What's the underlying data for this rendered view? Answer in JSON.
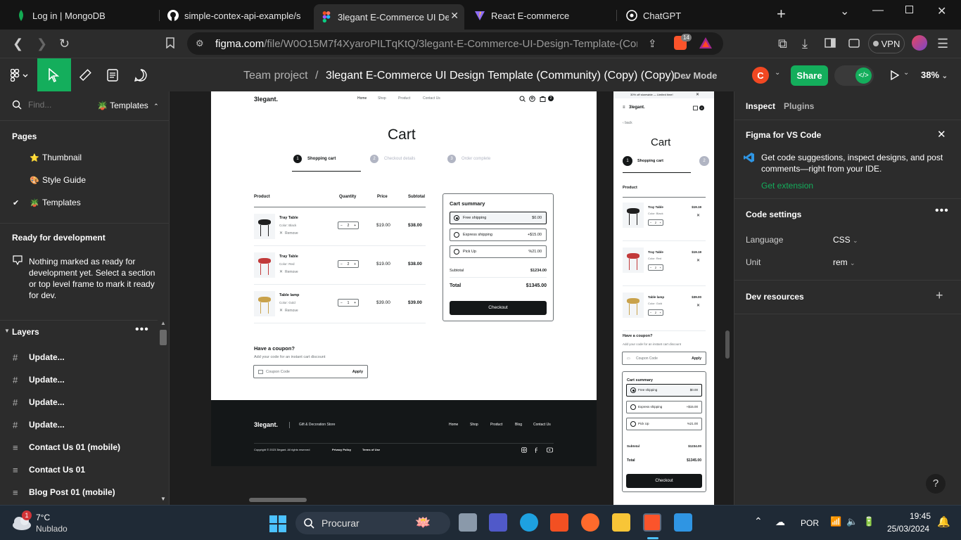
{
  "browser": {
    "tabs": [
      {
        "label": "Log in | MongoDB",
        "icon": "mongodb-leaf-icon",
        "active": false
      },
      {
        "label": "simple-contex-api-example/src/c",
        "icon": "github-icon",
        "active": false
      },
      {
        "label": "3legant E-Commerce UI Desig",
        "icon": "figma-icon",
        "active": true
      },
      {
        "label": "React E-commerce",
        "icon": "vite-icon",
        "active": false
      },
      {
        "label": "ChatGPT",
        "icon": "chatgpt-icon",
        "active": false
      }
    ],
    "url_host": "figma.com",
    "url_path": "/file/W0O15M7f4XyaroPILTqKtQ/3legant-E-Commerce-UI-Design-Template-(Commu...",
    "vpn_label": "VPN",
    "shield_badge": "14"
  },
  "figma": {
    "breadcrumb_team": "Team project",
    "breadcrumb_sep": "/",
    "file_title": "3legant E-Commerce UI Design Template (Community) (Copy) (Copy)",
    "dev_mode": "Dev Mode",
    "avatar_initial": "C",
    "share": "Share",
    "zoom": "38%"
  },
  "left_panel": {
    "search_placeholder": "Find...",
    "page_selector": "Templates",
    "pages_title": "Pages",
    "pages": [
      {
        "icon": "star-emoji-icon",
        "label": "Thumbnail"
      },
      {
        "icon": "palette-emoji-icon",
        "label": "Style Guide"
      },
      {
        "icon": "plant-emoji-icon",
        "label": "Templates",
        "checked": true
      }
    ],
    "ready_title": "Ready for development",
    "ready_text": "Nothing marked as ready for development yet. Select a section or top level frame to mark it ready for dev.",
    "layers_title": "Layers",
    "layers": [
      {
        "type": "frame-hash-icon",
        "label": "Update..."
      },
      {
        "type": "frame-hash-icon",
        "label": "Update..."
      },
      {
        "type": "frame-hash-icon",
        "label": "Update..."
      },
      {
        "type": "frame-hash-icon",
        "label": "Update..."
      },
      {
        "type": "section-lines-icon",
        "label": "Contact Us 01 (mobile)"
      },
      {
        "type": "section-lines-icon",
        "label": "Contact Us 01"
      },
      {
        "type": "section-lines-icon",
        "label": "Blog Post 01 (mobile)"
      }
    ]
  },
  "desktop_cart": {
    "logo": "3legant.",
    "nav": [
      "Home",
      "Shop",
      "Product",
      "Contact Us"
    ],
    "cart_count": "2",
    "title": "Cart",
    "steps": [
      {
        "num": "1",
        "label": "Shopping cart"
      },
      {
        "num": "2",
        "label": "Checkout details"
      },
      {
        "num": "3",
        "label": "Order complete"
      }
    ],
    "headers": {
      "product": "Product",
      "quantity": "Quantity",
      "price": "Price",
      "subtotal": "Subtotal"
    },
    "items": [
      {
        "name": "Tray Table",
        "color": "Color: Black",
        "remove": "Remove",
        "qty": "2",
        "price": "$19.00",
        "subtotal": "$38.00",
        "swatch": "#1f1f1f"
      },
      {
        "name": "Tray Table",
        "color": "Color: Red",
        "remove": "Remove",
        "qty": "2",
        "price": "$19.00",
        "subtotal": "$38.00",
        "swatch": "#c23a3a"
      },
      {
        "name": "Table lamp",
        "color": "Color: Gold",
        "remove": "Remove",
        "qty": "1",
        "price": "$39.00",
        "subtotal": "$39.00",
        "swatch": "#c9a24b"
      }
    ],
    "summary": {
      "title": "Cart summary",
      "options": [
        {
          "label": "Free shipping",
          "price": "$0.00",
          "selected": true
        },
        {
          "label": "Express shipping",
          "price": "+$15.00",
          "selected": false
        },
        {
          "label": "Pick Up",
          "price": "%21.00",
          "selected": false
        }
      ],
      "subtotal_label": "Subtotal",
      "subtotal_value": "$1234.00",
      "total_label": "Total",
      "total_value": "$1345.00",
      "checkout": "Checkout"
    },
    "coupon": {
      "title": "Have a coupon?",
      "subtitle": "Add your code for an instant cart discount",
      "placeholder": "Coupon Code",
      "apply": "Apply"
    },
    "footer": {
      "logo": "3legant.",
      "tagline": "Gift & Decoration Store",
      "links": [
        "Home",
        "Shop",
        "Product",
        "Blog",
        "Contact Us"
      ],
      "copyright": "Copyright © 2023 3legant. All rights reserved",
      "privacy": "Privacy Policy",
      "terms": "Terms of Use"
    }
  },
  "mobile_cart": {
    "promo": "30% off storewide — Limited time!",
    "logo": "3legant.",
    "cart_count": "2",
    "back": "back",
    "title": "Cart",
    "step1": "Shopping cart",
    "step2_num": "2",
    "step1_num": "1",
    "product_header": "Product",
    "items": [
      {
        "name": "Tray Table",
        "color": "Color: Black",
        "price": "$19.19",
        "qty": "2",
        "swatch": "#1f1f1f"
      },
      {
        "name": "Tray Table",
        "color": "Color: Red",
        "price": "$19.19",
        "qty": "2",
        "swatch": "#c23a3a"
      },
      {
        "name": "Table lamp",
        "color": "Color: Gold",
        "price": "$39.00",
        "qty": "2",
        "swatch": "#c9a24b"
      }
    ],
    "coupon_title": "Have a coupon?",
    "coupon_sub": "Add your code for an instant cart discount",
    "coupon_placeholder": "Coupon Code",
    "apply": "Apply",
    "summary_title": "Cart summary",
    "options": [
      {
        "label": "Free shipping",
        "price": "$0.00",
        "selected": true
      },
      {
        "label": "Express shipping",
        "price": "+$15.00",
        "selected": false
      },
      {
        "label": "Pick Up",
        "price": "%21.00",
        "selected": false
      }
    ],
    "subtotal_label": "Subtotal",
    "subtotal_value": "$1234.00",
    "total_label": "Total",
    "total_value": "$1345.00",
    "checkout": "Checkout"
  },
  "right_panel": {
    "tabs": [
      "Inspect",
      "Plugins"
    ],
    "vscode_title": "Figma for VS Code",
    "vscode_text": "Get code suggestions, inspect designs, and post comments—right from your IDE.",
    "vscode_link": "Get extension",
    "code_settings": "Code settings",
    "language_label": "Language",
    "language_value": "CSS",
    "unit_label": "Unit",
    "unit_value": "rem",
    "dev_resources": "Dev resources",
    "help": "?"
  },
  "taskbar": {
    "weather_temp": "7°C",
    "weather_desc": "Nublado",
    "weather_badge": "1",
    "search_placeholder": "Procurar",
    "language": "POR",
    "time": "19:45",
    "date": "25/03/2024"
  },
  "colors": {
    "figma_green": "#14ae5c",
    "figma_bg": "#2c2c2c",
    "canvas_bg": "#1e1e1e",
    "accent_blue": "#0c8ce9",
    "cart_dark": "#141718"
  }
}
